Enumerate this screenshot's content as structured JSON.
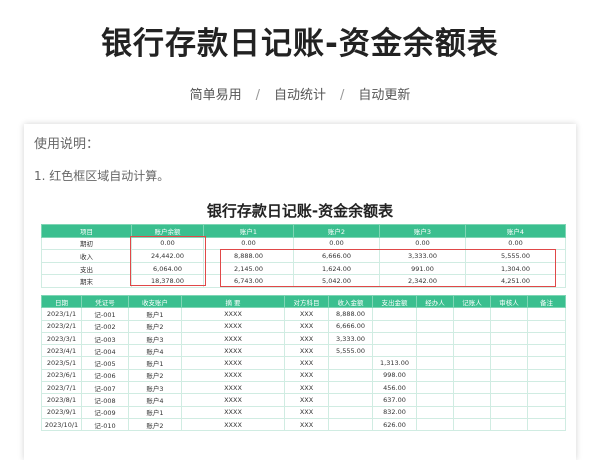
{
  "header": {
    "title": "银行存款日记账-资金余额表",
    "tags": [
      "简单易用",
      "自动统计",
      "自动更新"
    ],
    "separator": "/"
  },
  "card": {
    "usage_title": "使用说明：",
    "usage_items": [
      "1. 红色框区域自动计算。"
    ],
    "sheet_title": "银行存款日记账-资金余额表"
  },
  "summary": {
    "columns": [
      "项目",
      "账户余额",
      "账户1",
      "账户2",
      "账户3",
      "账户4"
    ],
    "rows": [
      [
        "期初",
        "0.00",
        "0.00",
        "0.00",
        "0.00",
        "0.00"
      ],
      [
        "收入",
        "24,442.00",
        "8,888.00",
        "6,666.00",
        "3,333.00",
        "5,555.00"
      ],
      [
        "支出",
        "6,064.00",
        "2,145.00",
        "1,624.00",
        "991.00",
        "1,304.00"
      ],
      [
        "期末",
        "18,378.00",
        "6,743.00",
        "5,042.00",
        "2,342.00",
        "4,251.00"
      ]
    ]
  },
  "detail": {
    "columns": [
      "日期",
      "凭证号",
      "收支账户",
      "摘 要",
      "对方科目",
      "收入金额",
      "支出金额",
      "经办人",
      "记账人",
      "审核人",
      "备注"
    ],
    "rows": [
      [
        "2023/1/1",
        "记-001",
        "账户1",
        "XXXX",
        "XXX",
        "8,888.00",
        "",
        "",
        "",
        "",
        ""
      ],
      [
        "2023/2/1",
        "记-002",
        "账户2",
        "XXXX",
        "XXX",
        "6,666.00",
        "",
        "",
        "",
        "",
        ""
      ],
      [
        "2023/3/1",
        "记-003",
        "账户3",
        "XXXX",
        "XXX",
        "3,333.00",
        "",
        "",
        "",
        "",
        ""
      ],
      [
        "2023/4/1",
        "记-004",
        "账户4",
        "XXXX",
        "XXX",
        "5,555.00",
        "",
        "",
        "",
        "",
        ""
      ],
      [
        "2023/5/1",
        "记-005",
        "账户1",
        "XXXX",
        "XXX",
        "",
        "1,313.00",
        "",
        "",
        "",
        ""
      ],
      [
        "2023/6/1",
        "记-006",
        "账户2",
        "XXXX",
        "XXX",
        "",
        "998.00",
        "",
        "",
        "",
        ""
      ],
      [
        "2023/7/1",
        "记-007",
        "账户3",
        "XXXX",
        "XXX",
        "",
        "456.00",
        "",
        "",
        "",
        ""
      ],
      [
        "2023/8/1",
        "记-008",
        "账户4",
        "XXXX",
        "XXX",
        "",
        "637.00",
        "",
        "",
        "",
        ""
      ],
      [
        "2023/9/1",
        "记-009",
        "账户1",
        "XXXX",
        "XXX",
        "",
        "832.00",
        "",
        "",
        "",
        ""
      ],
      [
        "2023/10/1",
        "记-010",
        "账户2",
        "XXXX",
        "XXX",
        "",
        "626.00",
        "",
        "",
        "",
        ""
      ]
    ]
  },
  "colors": {
    "header_green": "#3bbf8f",
    "highlight_red": "#e04848"
  }
}
